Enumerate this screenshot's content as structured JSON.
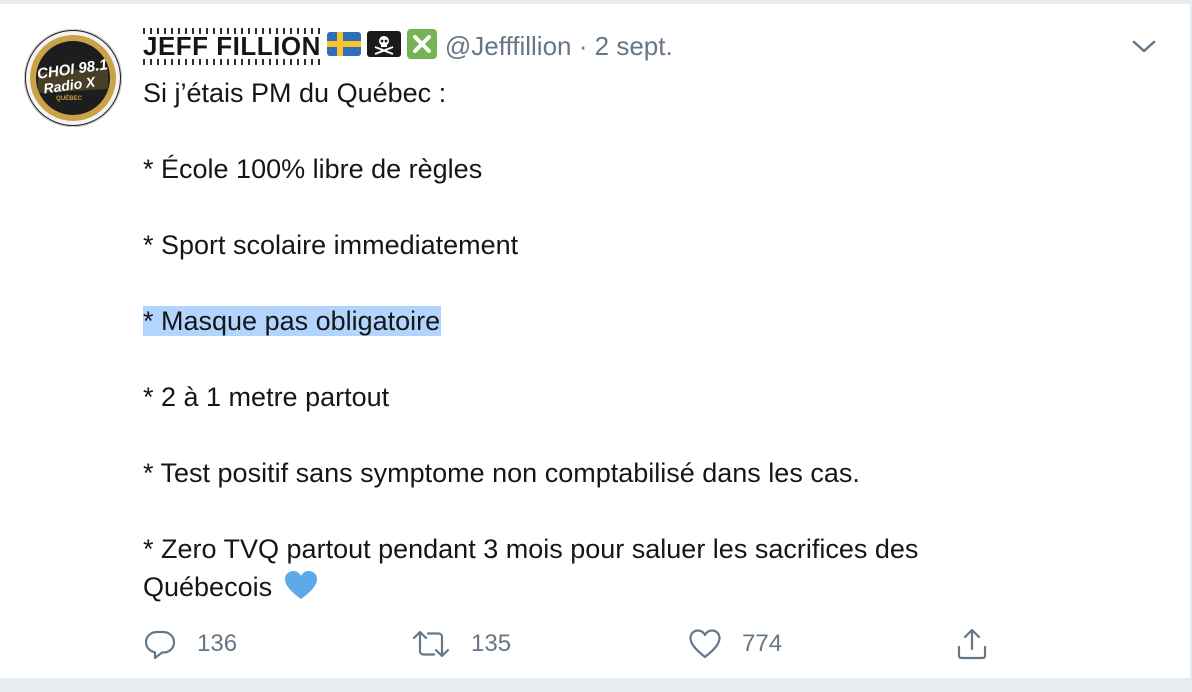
{
  "tweet": {
    "display_name": "JEFF FILLION",
    "handle": "@Jefffillion",
    "separator": "·",
    "date": "2 sept.",
    "lines": {
      "l0": "Si j’étais PM du Québec :",
      "l1": "* École 100% libre de règles",
      "l2": "* Sport scolaire immediatement",
      "l3": "* Masque pas obligatoire",
      "l4": "* 2 à 1 metre partout",
      "l5": "* Test positif sans symptome non comptabilisé dans les cas.",
      "l6": "* Zero TVQ partout pendant 3 mois pour  saluer les sacrifices des",
      "l7": "Québecois"
    },
    "avatar_text": {
      "brand": "CHOI 98.1",
      "sub": "Radio X",
      "city": "QUÉBEC"
    }
  },
  "actions": {
    "replies": "136",
    "retweets": "135",
    "likes": "774"
  },
  "icons": {
    "flag": "sweden-flag-icon",
    "pirate": "pirate-flag-icon",
    "cross": "cross-mark-icon",
    "heart_emoji": "blue-heart-icon",
    "reply": "reply-icon",
    "retweet": "retweet-icon",
    "like": "like-icon",
    "share": "share-icon",
    "menu": "chevron-down-icon"
  },
  "colors": {
    "text": "#14171a",
    "secondary": "#657786",
    "highlight": "#b3d4fc",
    "heart": "#5da9e9"
  }
}
